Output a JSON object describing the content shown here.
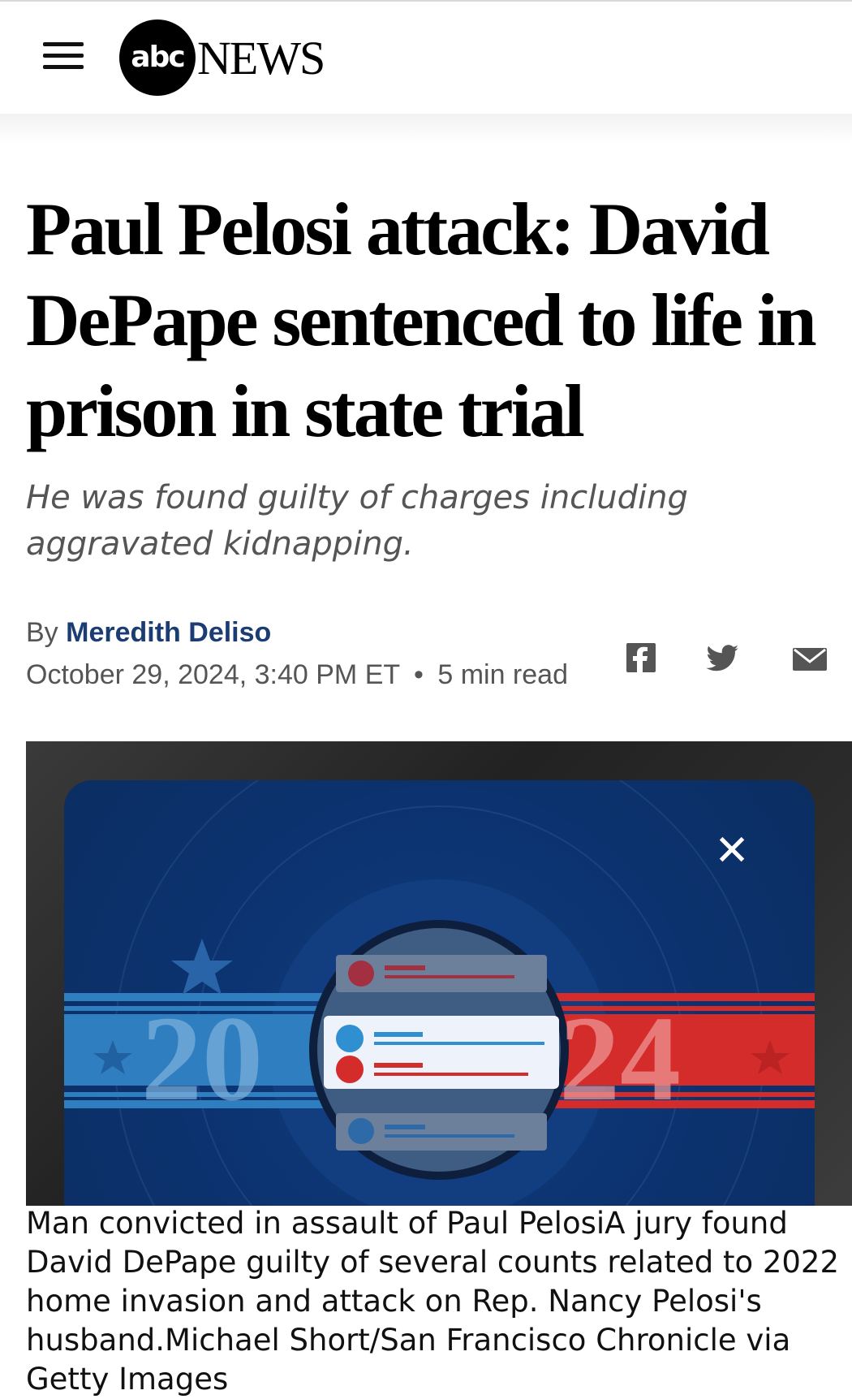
{
  "header": {
    "logo_mark": "abc",
    "logo_wordmark": "NEWS"
  },
  "article": {
    "headline": "Paul Pelosi attack: David DePape sentenced to life in prison in state trial",
    "subheadline": "He was found guilty of charges including aggravated kidnapping.",
    "byline_prefix": "By",
    "author": "Meredith Deliso",
    "date": "October 29, 2024, 3:40 PM ET",
    "separator": "•",
    "read_time": "5 min read"
  },
  "share": {
    "icons": [
      "facebook-icon",
      "twitter-icon",
      "email-icon"
    ]
  },
  "media": {
    "promo_year_left": "20",
    "promo_year_right": "24",
    "close_glyph": "✕",
    "caption": "Man convicted in assault of Paul PelosiA jury found David DePape guilty of several counts related to 2022 home invasion and attack on Rep. Nancy Pelosi's husband.Michael Short/San Francisco Chronicle via Getty Images"
  },
  "colors": {
    "author_link": "#1b3d74",
    "promo_blue": "#0c3472",
    "promo_red": "#d42b2b",
    "promo_stripe_blue": "#2f7fc0"
  }
}
